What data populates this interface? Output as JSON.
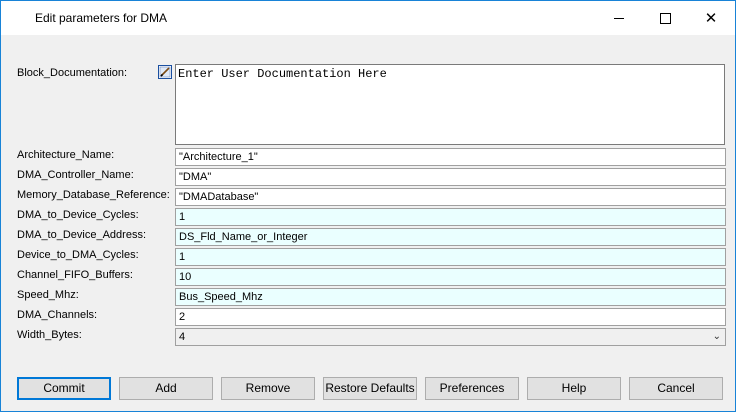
{
  "window": {
    "title": "Edit parameters for DMA"
  },
  "params": {
    "block_documentation": {
      "label": "Block_Documentation:",
      "value": "Enter User Documentation Here"
    },
    "architecture_name": {
      "label": "Architecture_Name:",
      "value": "\"Architecture_1\""
    },
    "dma_controller_name": {
      "label": "DMA_Controller_Name:",
      "value": "\"DMA\""
    },
    "memory_database_reference": {
      "label": "Memory_Database_Reference:",
      "value": "\"DMADatabase\""
    },
    "dma_to_device_cycles": {
      "label": "DMA_to_Device_Cycles:",
      "value": "1"
    },
    "dma_to_device_address": {
      "label": "DMA_to_Device_Address:",
      "value": "DS_Fld_Name_or_Integer"
    },
    "device_to_dma_cycles": {
      "label": "Device_to_DMA_Cycles:",
      "value": "1"
    },
    "channel_fifo_buffers": {
      "label": "Channel_FIFO_Buffers:",
      "value": "10"
    },
    "speed_mhz": {
      "label": "Speed_Mhz:",
      "value": "Bus_Speed_Mhz"
    },
    "dma_channels": {
      "label": "DMA_Channels:",
      "value": "2"
    },
    "width_bytes": {
      "label": "Width_Bytes:",
      "value": "4"
    }
  },
  "buttons": {
    "commit": "Commit",
    "add": "Add",
    "remove": "Remove",
    "restore_defaults": "Restore Defaults",
    "preferences": "Preferences",
    "help": "Help",
    "cancel": "Cancel"
  },
  "icons": {
    "minimize": "minimize-icon",
    "maximize": "maximize-icon",
    "close": "close-icon",
    "edit_doc": "edit-documentation-icon",
    "dropdown": "chevron-down-icon"
  },
  "colors": {
    "accent": "#0078d7",
    "cyan_field": "#eaffff"
  }
}
